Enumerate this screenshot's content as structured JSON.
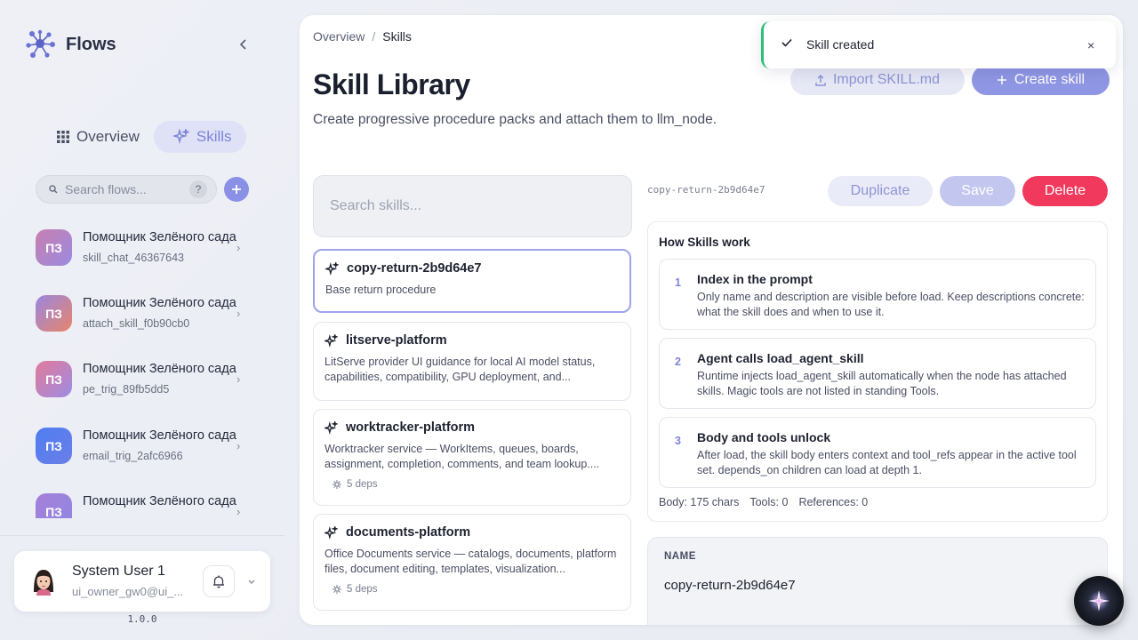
{
  "brand": {
    "name": "Flows"
  },
  "nav": {
    "overview_label": "Overview",
    "skills_label": "Skills"
  },
  "sidebar_search": {
    "placeholder": "Search flows...",
    "help": "?"
  },
  "flows": [
    {
      "initials": "ПЗ",
      "title": "Помощник Зелёного сада",
      "subtitle": "skill_chat_46367643"
    },
    {
      "initials": "ПЗ",
      "title": "Помощник Зелёного сада",
      "subtitle": "attach_skill_f0b90cb0"
    },
    {
      "initials": "ПЗ",
      "title": "Помощник Зелёного сада",
      "subtitle": "pe_trig_89fb5dd5"
    },
    {
      "initials": "ПЗ",
      "title": "Помощник Зелёного сада",
      "subtitle": "email_trig_2afc6966"
    },
    {
      "initials": "ПЗ",
      "title": "Помощник Зелёного сада",
      "subtitle": ""
    }
  ],
  "user": {
    "name": "System User 1",
    "email": "ui_owner_gw0@ui_..."
  },
  "version": "1.0.0",
  "breadcrumb": {
    "root": "Overview",
    "separator": "/",
    "current": "Skills"
  },
  "page": {
    "title": "Skill Library",
    "subtitle": "Create progressive procedure packs and attach them to llm_node.",
    "import_label": "Import SKILL.md",
    "create_label": "Create skill"
  },
  "skill_search": {
    "placeholder": "Search skills..."
  },
  "skills": [
    {
      "name": "copy-return-2b9d64e7",
      "description": "Base return procedure",
      "deps": ""
    },
    {
      "name": "litserve-platform",
      "description": "LitServe provider UI guidance for local AI model status, capabilities, compatibility, GPU deployment, and...",
      "deps": ""
    },
    {
      "name": "worktracker-platform",
      "description": "Worktracker service — WorkItems, queues, boards, assignment, completion, comments, and team lookup....",
      "deps": "5 deps"
    },
    {
      "name": "documents-platform",
      "description": "Office Documents service — catalogs, documents, platform files, document editing, templates, visualization...",
      "deps": "5 deps"
    }
  ],
  "detail": {
    "id": "copy-return-2b9d64e7",
    "duplicate_label": "Duplicate",
    "save_label": "Save",
    "delete_label": "Delete",
    "how_title": "How Skills work",
    "steps": [
      {
        "num": "1",
        "title": "Index in the prompt",
        "text": "Only name and description are visible before load. Keep descriptions concrete: what the skill does and when to use it."
      },
      {
        "num": "2",
        "title": "Agent calls load_agent_skill",
        "text": "Runtime injects load_agent_skill automatically when the node has attached skills. Magic tools are not listed in standing Tools."
      },
      {
        "num": "3",
        "title": "Body and tools unlock",
        "text": "After load, the skill body enters context and tool_refs appear in the active tool set. depends_on children can load at depth 1."
      }
    ],
    "stats": {
      "body": "Body: 175 chars",
      "tools": "Tools: 0",
      "references": "References: 0"
    },
    "name_label": "NAME",
    "name_value": "copy-return-2b9d64e7"
  },
  "toast": {
    "text": "Skill created",
    "close": "×"
  },
  "colors": {
    "accent": "#8f96e3",
    "danger": "#f0395c",
    "success": "#2fbf7a"
  }
}
